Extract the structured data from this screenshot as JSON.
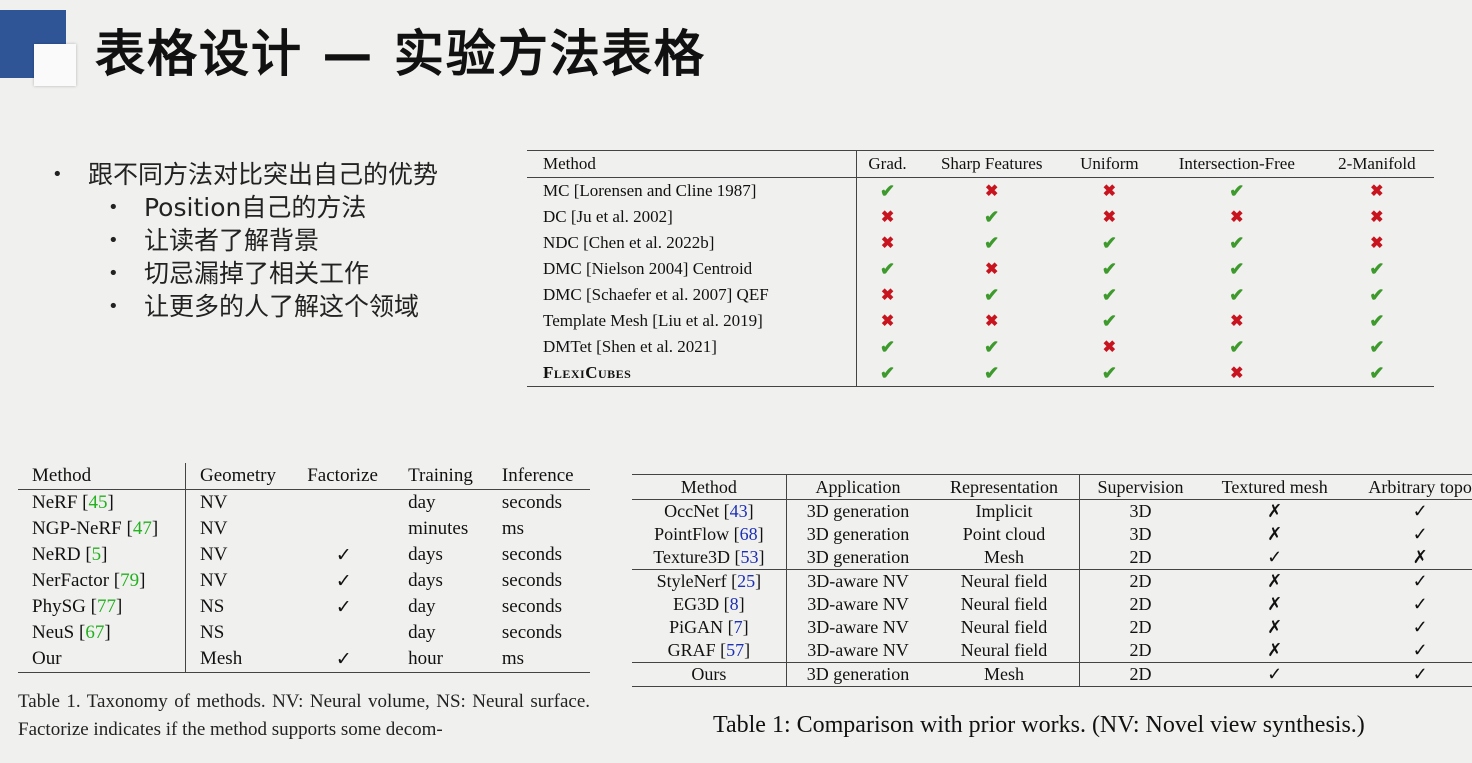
{
  "title": "表格设计 — 实验方法表格",
  "bullets": {
    "main": "跟不同方法对比突出自己的优势",
    "sub": [
      "Position自己的方法",
      "让读者了解背景",
      "切忌漏掉了相关工作",
      "让更多的人了解这个领域"
    ]
  },
  "table_flexi": {
    "headers": [
      "Method",
      "Grad.",
      "Sharp Features",
      "Uniform",
      "Intersection-Free",
      "2-Manifold"
    ],
    "rows": [
      {
        "method": "MC [Lorensen and Cline 1987]",
        "vals": [
          "✔",
          "✖",
          "✖",
          "✔",
          "✖"
        ]
      },
      {
        "method": "DC [Ju et al. 2002]",
        "vals": [
          "✖",
          "✔",
          "✖",
          "✖",
          "✖"
        ]
      },
      {
        "method": "NDC [Chen et al. 2022b]",
        "vals": [
          "✖",
          "✔",
          "✔",
          "✔",
          "✖"
        ]
      },
      {
        "method": "DMC [Nielson 2004] Centroid",
        "vals": [
          "✔",
          "✖",
          "✔",
          "✔",
          "✔"
        ]
      },
      {
        "method": "DMC [Schaefer et al. 2007] QEF",
        "vals": [
          "✖",
          "✔",
          "✔",
          "✔",
          "✔"
        ]
      },
      {
        "method": "Template Mesh [Liu et al. 2019]",
        "vals": [
          "✖",
          "✖",
          "✔",
          "✖",
          "✔"
        ]
      },
      {
        "method": "DMTet [Shen et al. 2021]",
        "vals": [
          "✔",
          "✔",
          "✖",
          "✔",
          "✔"
        ]
      },
      {
        "method": "FlexiCubes",
        "vals": [
          "✔",
          "✔",
          "✔",
          "✖",
          "✔"
        ]
      }
    ]
  },
  "table_taxonomy": {
    "headers": [
      "Method",
      "Geometry",
      "Factorize",
      "Training",
      "Inference"
    ],
    "rows": [
      {
        "name": "NeRF",
        "ref": "45",
        "geometry": "NV",
        "factorize": "",
        "training": "day",
        "inference": "seconds"
      },
      {
        "name": "NGP-NeRF",
        "ref": "47",
        "geometry": "NV",
        "factorize": "",
        "training": "minutes",
        "inference": "ms"
      },
      {
        "name": "NeRD",
        "ref": "5",
        "geometry": "NV",
        "factorize": "✓",
        "training": "days",
        "inference": "seconds"
      },
      {
        "name": "NerFactor",
        "ref": "79",
        "geometry": "NV",
        "factorize": "✓",
        "training": "days",
        "inference": "seconds"
      },
      {
        "name": "PhySG",
        "ref": "77",
        "geometry": "NS",
        "factorize": "✓",
        "training": "day",
        "inference": "seconds"
      },
      {
        "name": "NeuS",
        "ref": "67",
        "geometry": "NS",
        "factorize": "",
        "training": "day",
        "inference": "seconds"
      },
      {
        "name": "Our",
        "ref": "",
        "geometry": "Mesh",
        "factorize": "✓",
        "training": "hour",
        "inference": "ms"
      }
    ],
    "caption": "Table 1. Taxonomy of methods. NV: Neural volume, NS: Neural surface. Factorize indicates if the method supports some decom-"
  },
  "table_compare": {
    "headers": [
      "Method",
      "Application",
      "Representation",
      "Supervision",
      "Textured mesh",
      "Arbitrary topo"
    ],
    "rows": [
      {
        "name": "OccNet",
        "ref": "43",
        "app": "3D generation",
        "rep": "Implicit",
        "sup": "3D",
        "tex": "✗",
        "topo": "✓"
      },
      {
        "name": "PointFlow",
        "ref": "68",
        "app": "3D generation",
        "rep": "Point cloud",
        "sup": "3D",
        "tex": "✗",
        "topo": "✓"
      },
      {
        "name": "Texture3D",
        "ref": "53",
        "app": "3D generation",
        "rep": "Mesh",
        "sup": "2D",
        "tex": "✓",
        "topo": "✗"
      },
      {
        "name": "StyleNerf",
        "ref": "25",
        "app": "3D-aware NV",
        "rep": "Neural field",
        "sup": "2D",
        "tex": "✗",
        "topo": "✓"
      },
      {
        "name": "EG3D",
        "ref": "8",
        "app": "3D-aware NV",
        "rep": "Neural field",
        "sup": "2D",
        "tex": "✗",
        "topo": "✓"
      },
      {
        "name": "PiGAN",
        "ref": "7",
        "app": "3D-aware NV",
        "rep": "Neural field",
        "sup": "2D",
        "tex": "✗",
        "topo": "✓"
      },
      {
        "name": "GRAF",
        "ref": "57",
        "app": "3D-aware NV",
        "rep": "Neural field",
        "sup": "2D",
        "tex": "✗",
        "topo": "✓"
      },
      {
        "name": "Ours",
        "ref": "",
        "app": "3D generation",
        "rep": "Mesh",
        "sup": "2D",
        "tex": "✓",
        "topo": "✓"
      }
    ],
    "caption": "Table 1: Comparison with prior works. (NV: Novel view synthesis.)"
  },
  "colors": {
    "accent": "#2f5597",
    "check": "#3f9a2e",
    "cross": "#c8141e",
    "cite_green": "#23b11f",
    "cite_blue": "#1c2fb5"
  }
}
